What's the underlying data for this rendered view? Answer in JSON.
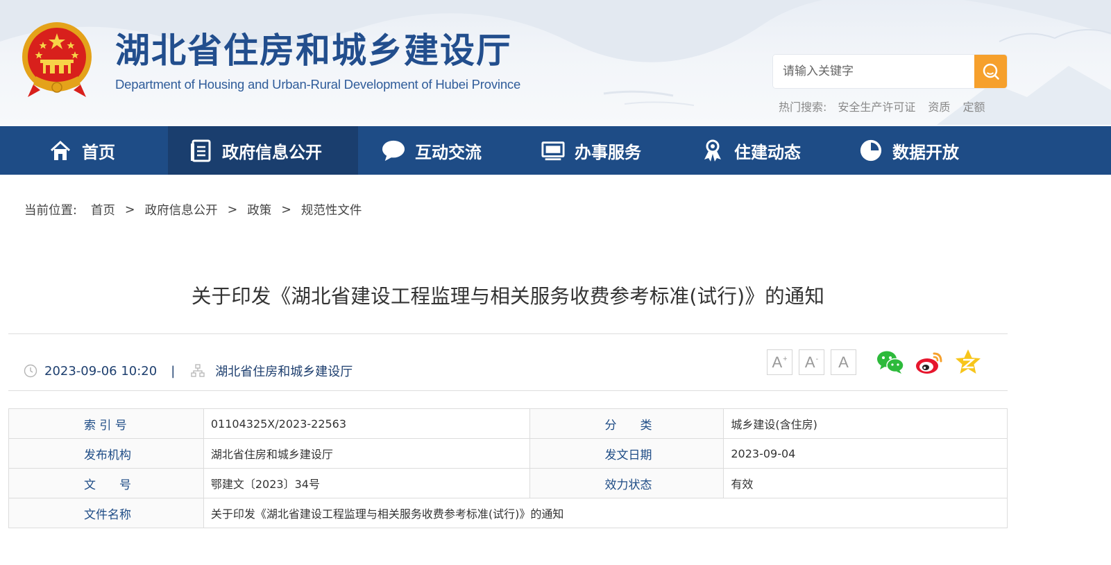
{
  "header": {
    "site_title": "湖北省住房和城乡建设厅",
    "site_subtitle": "Department of Housing and Urban-Rural Development of Hubei Province",
    "search_placeholder": "请输入关键字",
    "hot_label": "热门搜索:",
    "hot_terms": [
      "安全生产许可证",
      "资质",
      "定额"
    ]
  },
  "nav": {
    "items": [
      {
        "label": "首页",
        "icon": "home-icon"
      },
      {
        "label": "政府信息公开",
        "icon": "document-list-icon",
        "active": true
      },
      {
        "label": "互动交流",
        "icon": "chat-bubble-icon"
      },
      {
        "label": "办事服务",
        "icon": "monitor-icon"
      },
      {
        "label": "住建动态",
        "icon": "award-person-icon"
      },
      {
        "label": "数据开放",
        "icon": "pie-chart-icon"
      }
    ]
  },
  "breadcrumb": {
    "label": "当前位置:",
    "items": [
      "首页",
      "政府信息公开",
      "政策",
      "规范性文件"
    ],
    "separator": ">"
  },
  "article": {
    "title": "关于印发《湖北省建设工程监理与相关服务收费参考标准(试行)》的通知",
    "datetime": "2023-09-06 10:20",
    "divider": "|",
    "source": "湖北省住房和城乡建设厅"
  },
  "tools": {
    "font_large": "A",
    "font_large_sup": "+",
    "font_small": "A",
    "font_small_sup": "-",
    "font_default": "A",
    "share_icons": [
      "wechat-icon",
      "weibo-icon",
      "qzone-icon"
    ]
  },
  "info_table": {
    "rows": [
      {
        "k1": "索 引 号",
        "v1": "01104325X/2023-22563",
        "k2": "分　　类",
        "v2": "城乡建设(含住房)"
      },
      {
        "k1": "发布机构",
        "v1": "湖北省住房和城乡建设厅",
        "k2": "发文日期",
        "v2": "2023-09-04"
      },
      {
        "k1": "文　　号",
        "v1": "鄂建文〔2023〕34号",
        "k2": "效力状态",
        "v2": "有效"
      }
    ],
    "last_row": {
      "k": "文件名称",
      "v": "关于印发《湖北省建设工程监理与相关服务收费参考标准(试行)》的通知"
    }
  },
  "colors": {
    "nav_bg": "#1e4c86",
    "nav_active": "#1a3e6e",
    "title_blue": "#224e8d",
    "search_btn": "#f6a02c"
  }
}
